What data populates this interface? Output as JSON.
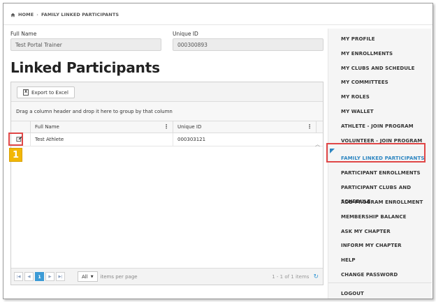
{
  "breadcrumb": {
    "home": "HOME",
    "separator": "›",
    "current": "FAMILY LINKED PARTICIPANTS"
  },
  "fields": {
    "full_name": {
      "label": "Full Name",
      "value": "Test Portal Trainer"
    },
    "unique_id": {
      "label": "Unique ID",
      "value": "000300893"
    }
  },
  "page_title": "Linked Participants",
  "grid": {
    "export_label": "Export to Excel",
    "group_hint": "Drag a column header and drop it here to group by that column",
    "columns": [
      "Full Name",
      "Unique ID"
    ],
    "rows": [
      {
        "full_name": "Test Athlete",
        "unique_id": "000303121"
      }
    ],
    "pager": {
      "current_page": "1",
      "page_size": "All",
      "items_per_page_label": "items per page",
      "range_text": "1 - 1 of 1 items"
    }
  },
  "callout_number": "1",
  "sidebar": {
    "items": [
      "MY PROFILE",
      "MY ENROLLMENTS",
      "MY CLUBS AND SCHEDULE",
      "MY COMMITTEES",
      "MY ROLES",
      "MY WALLET",
      "ATHLETE - JOIN PROGRAM",
      "VOLUNTEER - JOIN PROGRAM",
      "FAMILY LINKED PARTICIPANTS",
      "PARTICIPANT ENROLLMENTS",
      "PARTICIPANT CLUBS AND SCHEDULE",
      "ADD PROGRAM ENROLLMENT",
      "MEMBERSHIP BALANCE",
      "ASK MY CHAPTER",
      "INFORM MY CHAPTER",
      "HELP",
      "CHANGE PASSWORD",
      "LOGOUT"
    ],
    "active_index": 8
  },
  "colors": {
    "accent": "#2e86c1",
    "highlight": "#e04747",
    "callout": "#f2b705",
    "pager_active": "#3c9bd6"
  }
}
